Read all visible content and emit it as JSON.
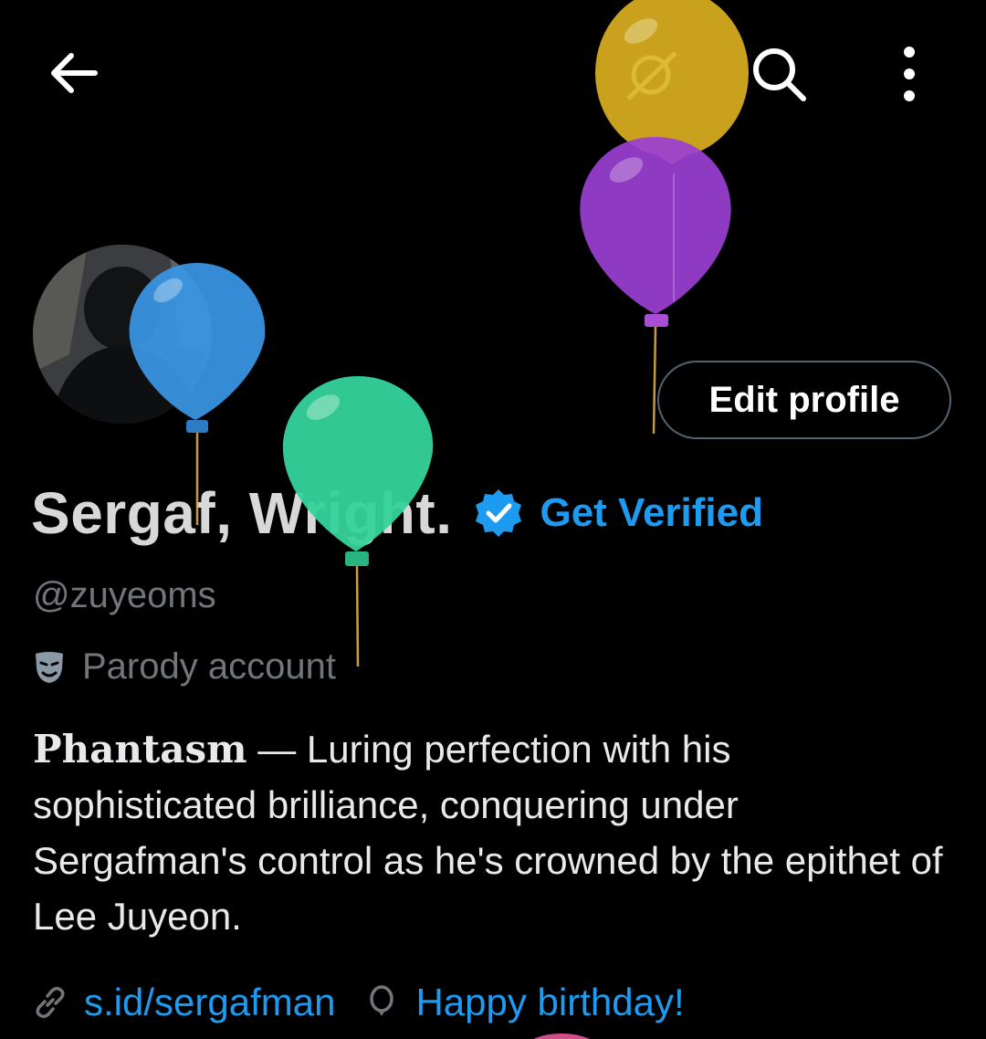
{
  "header": {
    "back_icon": "arrow-left-icon",
    "search_icon": "search-icon",
    "more_icon": "more-vertical-icon"
  },
  "profile": {
    "display_name": "Sergaf, Wright.",
    "verified_badge_icon": "verified-badge-icon",
    "get_verified_label": "Get Verified",
    "edit_profile_label": "Edit profile",
    "handle": "@zuyeoms",
    "parody_label": "Parody account",
    "parody_icon": "theater-mask-icon",
    "bio_lead": "Phantasm",
    "bio_text": " — Luring perfection with his sophisticated brilliance, conquering under Sergafman's control as he's crowned by the epithet of Lee Juyeon.",
    "website_icon": "link-icon",
    "website": "s.id/sergafman",
    "birthday_icon": "balloon-icon",
    "birthday_label": "Happy birthday!"
  },
  "colors": {
    "background": "#000000",
    "accent": "#1d9bf0",
    "muted_text": "#71767b",
    "balloon_yellow": "#e0b321",
    "balloon_purple": "#9b3fd3",
    "balloon_blue": "#3a97e6",
    "balloon_green": "#35d39c"
  }
}
